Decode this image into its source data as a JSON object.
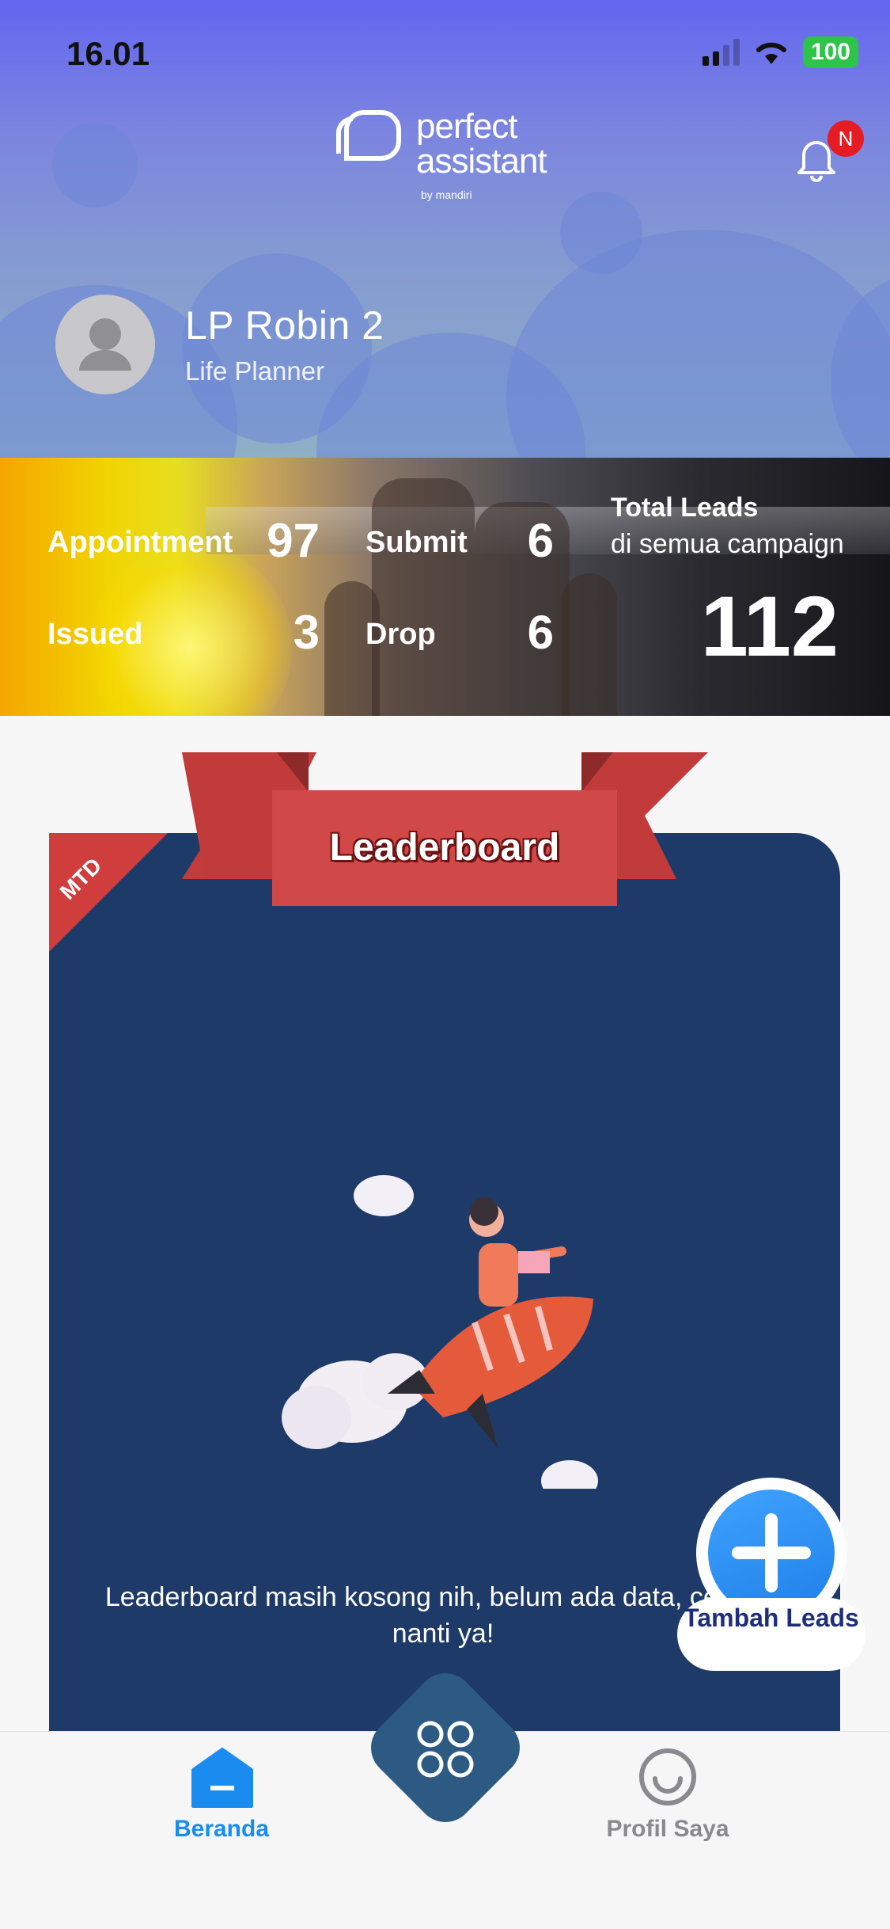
{
  "status_bar": {
    "time": "16.01",
    "battery": "100"
  },
  "header": {
    "logo_line1": "perfect",
    "logo_line2": "assistant",
    "logo_sub": "by  mandiri",
    "notification_badge": "N",
    "user_name": "LP Robin  2",
    "user_role": "Life Planner",
    "brand_color": "#6366f0"
  },
  "stats": {
    "appointment_label": "Appointment",
    "appointment_value": "97",
    "submit_label": "Submit",
    "submit_value": "6",
    "issued_label": "Issued",
    "issued_value": "3",
    "drop_label": "Drop",
    "drop_value": "6",
    "total_title": "Total Leads",
    "total_sub": "di semua campaign",
    "total_value": "112"
  },
  "leaderboard": {
    "title": "Leaderboard",
    "period_badge": "MTD",
    "empty_message": "Leaderboard masih kosong nih, belum ada data, cek lagi nanti ya!",
    "card_color": "#1e3a68",
    "ribbon_color": "#d04848"
  },
  "fab": {
    "label": "Tambah Leads"
  },
  "bottom_nav": {
    "home_label": "Beranda",
    "profile_label": "Profil Saya",
    "active_color": "#1a8cf0",
    "inactive_color": "#8a8a8e"
  }
}
